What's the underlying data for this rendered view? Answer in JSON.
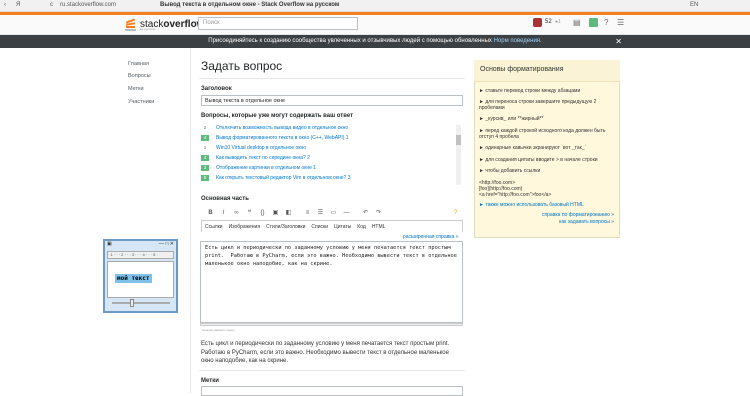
{
  "browser": {
    "url": "ru.stackoverflow.com",
    "title": "Вывод текста в отдельном окне - Stack Overflow на русском",
    "lang": "EN"
  },
  "header": {
    "logo_pre": "stack",
    "logo_bold": "overflow",
    "logo_sub": "на русском",
    "search_placeholder": "Поиск",
    "rep": "52",
    "badges": "●1"
  },
  "notice": {
    "text": "Присоединяйтесь к созданию сообщества увлеченных и отзывчивых людей с помощью обновленных ",
    "link": "Норм поведения.",
    "close": "✕"
  },
  "nav": [
    "Главная",
    "Вопросы",
    "Метки",
    "Участники"
  ],
  "page": {
    "title": "Задать вопрос",
    "title_label": "Заголовок",
    "title_value": "Вывод текста в отдельное окне",
    "similar_label": "Вопросы, которые уже могут содержать ваш ответ"
  },
  "similar": [
    {
      "score": "2",
      "text": "Отключить возможность вывода видео в отдельное окно",
      "pos": false
    },
    {
      "score": "4",
      "text": "Вывод форматированного текста в окно (C++, WebAPI) 1",
      "pos": true
    },
    {
      "score": "1",
      "text": "Win10 Virtual desktop в отдельное окно",
      "pos": false
    },
    {
      "score": "4",
      "text": "Как выводить текст по середине окна? 2",
      "pos": true
    },
    {
      "score": "3",
      "text": "Отображение картинки в отдельном окне 1",
      "pos": true
    },
    {
      "score": "5",
      "text": "Как открыть текстовый редактор Vim в отдельном окне? 3",
      "pos": true
    }
  ],
  "editor": {
    "label": "Основная часть",
    "tabs": [
      "Ссылки",
      "Изображения",
      "Стили/Заголовки",
      "Списки",
      "Цитаты",
      "Код",
      "HTML"
    ],
    "adv_help": "расширенная справка »",
    "body": "Есть цикл и периодически по заданному условию у меня печатается текст простым\nprint.  Работаю в PyCharm, если это важно. Необходимо вывести текст в отдельное\nмаленькое окно наподобие, как на скрине.",
    "hint": "меньше нажмите здесь",
    "preview": "Есть цикл и периодически по заданному условию у меня печатается текст простым print. Работаю в PyCharm, если это важно. Необходимо вывести текст в отдельное маленькое окно наподобие, как на скрине."
  },
  "tags_label": "Метки",
  "format": {
    "title": "Основы форматирования",
    "items": [
      "► ставьте перевод строки между абзацами",
      "► для переноса строки завершите предыдущую 2 пробелами",
      "► _курсив_ или **жирный**",
      "► перед каждой строкой исходного кода должен быть отступ 4 пробела",
      "► одинарные кавычки экранируют `вот _так_`",
      "► для создания цитаты вводите > в начале строки",
      "► чтобы добавить ссылки"
    ],
    "link_examples": "<http://foo.com>\n[foo](http://foo.com)\n<a href=\"http://foo.com\">foo</a>",
    "html_note": "► также можно использовать базовый HTML",
    "footer1": "справка по форматированию »",
    "footer2": "как задавать вопросы »"
  },
  "magnifier": {
    "ruler": "· 1 · · · 2 · · · 3 · · · 4 · · · 5 ·",
    "text": "мой текст",
    "close": "✕"
  }
}
